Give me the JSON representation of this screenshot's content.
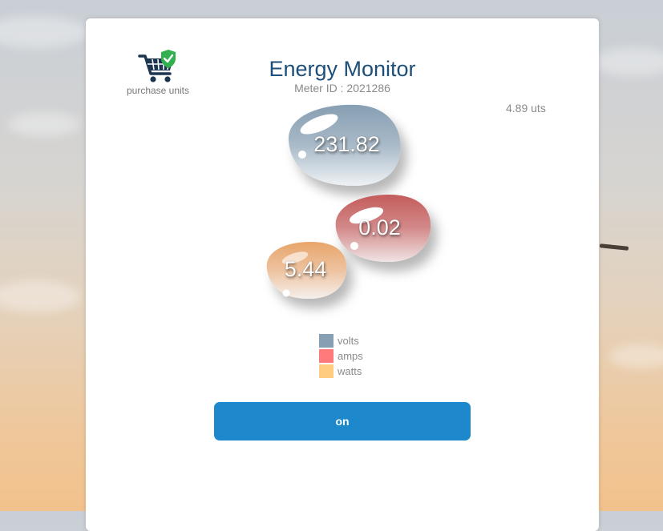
{
  "purchase": {
    "label": "purchase units",
    "icon": "shopping-cart-shield-icon"
  },
  "header": {
    "title": "Energy Monitor",
    "meter_id": "Meter ID : 2021286",
    "units": "4.89 uts"
  },
  "readings": {
    "volts": {
      "value": "231.82",
      "color": "#879fb3"
    },
    "amps": {
      "value": "0.02",
      "color": "#c45c5c"
    },
    "watts": {
      "value": "5.44",
      "color": "#e8a56a"
    }
  },
  "legend": [
    {
      "label": "volts",
      "color": "#879fb3"
    },
    {
      "label": "amps",
      "color": "#ff7b7b"
    },
    {
      "label": "watts",
      "color": "#ffcc80"
    }
  ],
  "power_button": {
    "label": "on",
    "color": "#1e88cc"
  }
}
